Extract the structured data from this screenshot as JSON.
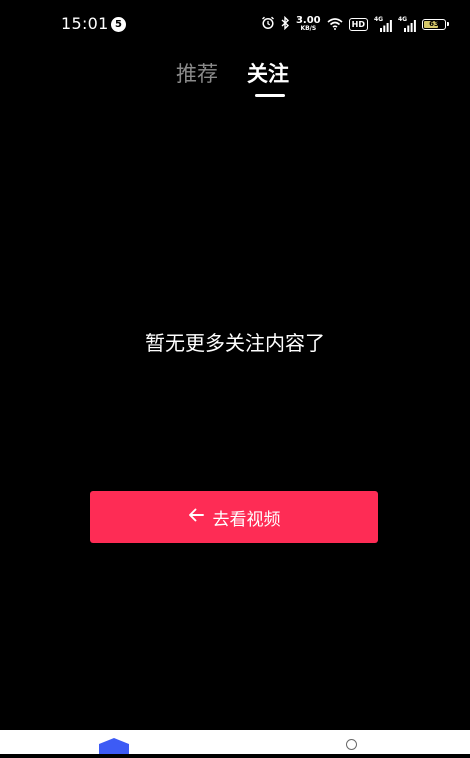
{
  "status_bar": {
    "time": "15:01",
    "notification_count": "5",
    "net_speed_value": "3.00",
    "net_speed_unit": "KB/S",
    "hd_label": "HD",
    "signal1_label": "4G",
    "signal2_label": "4G",
    "battery_level": "63"
  },
  "tabs": {
    "recommend_label": "推荐",
    "follow_label": "关注",
    "active": "follow"
  },
  "content": {
    "empty_message": "暂无更多关注内容了",
    "cta_label": "去看视频"
  },
  "colors": {
    "background": "#000000",
    "accent": "#fe2c55",
    "inactive_tab": "#8a8a8a",
    "home_icon": "#3d5bf5"
  },
  "icons": {
    "alarm": "alarm-icon",
    "bluetooth": "bluetooth-icon",
    "wifi": "wifi-icon",
    "back_arrow": "arrow-left-icon",
    "home": "home-icon",
    "profile": "profile-icon"
  }
}
